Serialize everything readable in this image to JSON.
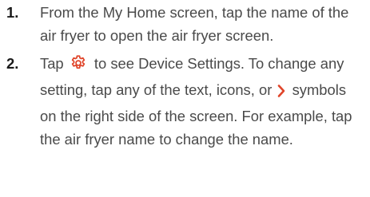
{
  "steps": [
    {
      "number": "1.",
      "text": "From the My Home screen, tap the name of the air fryer to open the air fryer screen."
    },
    {
      "number": "2.",
      "text_before_gear": "Tap",
      "text_after_gear": "to see Device Settings. To change any setting, tap any of the text, icons, or",
      "text_after_chevron": "symbols on the right side of the screen. For example, tap the air fryer name to change the name."
    }
  ],
  "icons": {
    "settings": "gear-icon",
    "arrow": "chevron-right-icon"
  },
  "colors": {
    "text": "#4a4a4a",
    "number": "#1a1a1a",
    "accent": "#e0452a"
  }
}
